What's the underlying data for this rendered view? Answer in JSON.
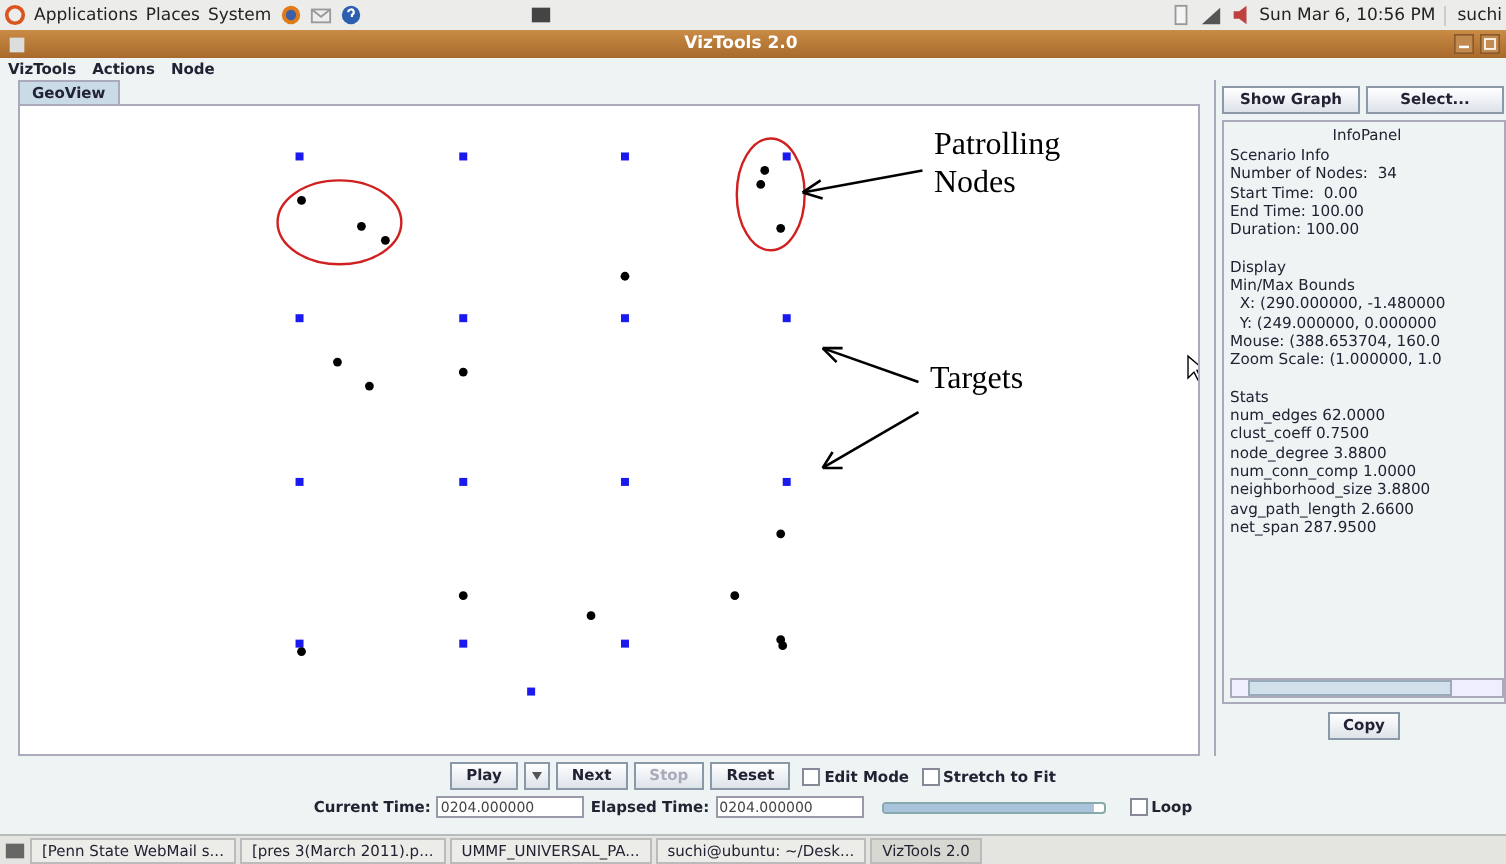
{
  "top_panel": {
    "menus": [
      "Applications",
      "Places",
      "System"
    ],
    "clock": "Sun Mar  6, 10:56 PM",
    "user": "suchi"
  },
  "window": {
    "title": "VizTools 2.0"
  },
  "menu_bar": [
    "VizTools",
    "Actions",
    "Node"
  ],
  "tabs": [
    {
      "label": "GeoView",
      "selected": true
    }
  ],
  "annotations": [
    {
      "text": "Patrolling Nodes"
    },
    {
      "text": "Targets"
    }
  ],
  "side_buttons": [
    "Show Graph",
    "Select..."
  ],
  "info_panel": {
    "title": "InfoPanel",
    "sections": [
      [
        "Scenario Info",
        "Number of Nodes:  34",
        "Start Time:  0.00",
        "End Time: 100.00",
        "Duration: 100.00"
      ],
      [
        "Display",
        "Min/Max Bounds",
        "  X: (290.000000, -1.480000",
        "  Y: (249.000000, 0.000000",
        "Mouse: (388.653704, 160.0",
        "Zoom Scale: (1.000000, 1.0"
      ],
      [
        "Stats",
        "num_edges 62.0000",
        "clust_coeff 0.7500",
        "node_degree 3.8800",
        "num_conn_comp 1.0000",
        "neighborhood_size 3.8800",
        "avg_path_length 2.6600",
        "net_span 287.9500"
      ]
    ],
    "copy_button": "Copy"
  },
  "controls": {
    "buttons": [
      {
        "label": "Play",
        "disabled": false
      },
      {
        "label": "Next",
        "disabled": false
      },
      {
        "label": "Stop",
        "disabled": true
      },
      {
        "label": "Reset",
        "disabled": false
      }
    ],
    "checkboxes": [
      {
        "label": "Edit Mode",
        "checked": false
      },
      {
        "label": "Stretch to Fit",
        "checked": false
      }
    ],
    "current_time_label": "Current Time:",
    "current_time": "0204.000000",
    "elapsed_time_label": "Elapsed Time:",
    "elapsed_time": "0204.000000",
    "slider": {
      "level": 0.96
    },
    "loop": {
      "label": "Loop",
      "checked": false
    }
  },
  "taskbar": [
    {
      "label": "[Penn State WebMail s...",
      "selected": false
    },
    {
      "label": "[pres 3(March 2011).p...",
      "selected": false
    },
    {
      "label": "UMMF_UNIVERSAL_PA...",
      "selected": false
    },
    {
      "label": "suchi@ubuntu: ~/Desk...",
      "selected": false
    },
    {
      "label": "VizTools 2.0",
      "selected": true
    }
  ]
}
